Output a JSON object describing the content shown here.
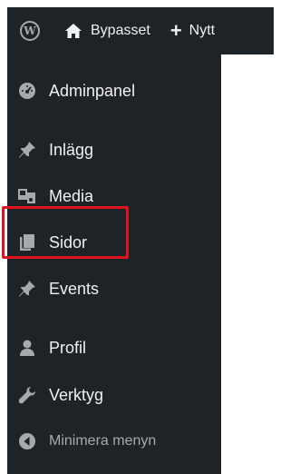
{
  "topbar": {
    "wp_logo_icon": "wordpress-icon",
    "site_icon": "home-icon",
    "site_name": "Bypasset",
    "new_icon": "plus-icon",
    "new_label": "Nytt"
  },
  "sidebar": {
    "items": [
      {
        "label": "Adminpanel",
        "icon": "dashboard-icon"
      },
      {
        "label": "Inlägg",
        "icon": "pin-icon"
      },
      {
        "label": "Media",
        "icon": "media-icon"
      },
      {
        "label": "Sidor",
        "icon": "pages-icon"
      },
      {
        "label": "Events",
        "icon": "pin-icon"
      },
      {
        "label": "Profil",
        "icon": "user-icon"
      },
      {
        "label": "Verktyg",
        "icon": "wrench-icon"
      }
    ],
    "collapse_label": "Minimera menyn",
    "collapse_icon": "collapse-arrow-icon"
  },
  "colors": {
    "bar_bg": "#1d2327",
    "text": "#f0f0f1",
    "icon": "#a7aaad",
    "highlight": "#e0141e"
  }
}
